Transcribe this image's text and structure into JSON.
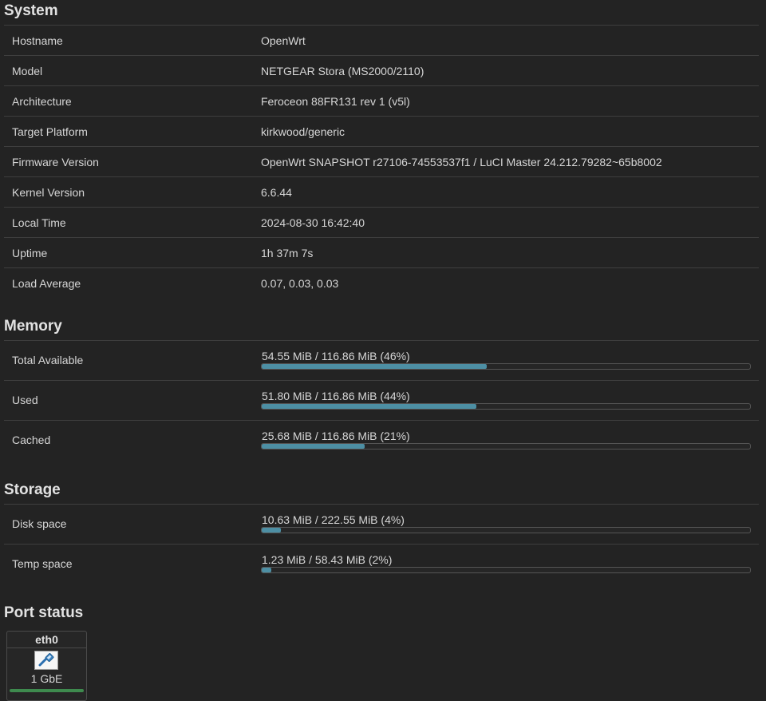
{
  "system": {
    "title": "System",
    "rows": [
      {
        "label": "Hostname",
        "value": "OpenWrt"
      },
      {
        "label": "Model",
        "value": "NETGEAR Stora (MS2000/2110)"
      },
      {
        "label": "Architecture",
        "value": "Feroceon 88FR131 rev 1 (v5l)"
      },
      {
        "label": "Target Platform",
        "value": "kirkwood/generic"
      },
      {
        "label": "Firmware Version",
        "value": "OpenWrt SNAPSHOT r27106-74553537f1 / LuCI Master 24.212.79282~65b8002"
      },
      {
        "label": "Kernel Version",
        "value": "6.6.44"
      },
      {
        "label": "Local Time",
        "value": "2024-08-30 16:42:40"
      },
      {
        "label": "Uptime",
        "value": "1h 37m 7s"
      },
      {
        "label": "Load Average",
        "value": "0.07, 0.03, 0.03"
      }
    ]
  },
  "memory": {
    "title": "Memory",
    "rows": [
      {
        "label": "Total Available",
        "text": "54.55 MiB / 116.86 MiB (46%)",
        "percent": 46
      },
      {
        "label": "Used",
        "text": "51.80 MiB / 116.86 MiB (44%)",
        "percent": 44
      },
      {
        "label": "Cached",
        "text": "25.68 MiB / 116.86 MiB (21%)",
        "percent": 21
      }
    ]
  },
  "storage": {
    "title": "Storage",
    "rows": [
      {
        "label": "Disk space",
        "text": "10.63 MiB / 222.55 MiB (4%)",
        "percent": 4
      },
      {
        "label": "Temp space",
        "text": "1.23 MiB / 58.43 MiB (2%)",
        "percent": 2
      }
    ]
  },
  "port_status": {
    "title": "Port status",
    "ports": [
      {
        "name": "eth0",
        "speed": "1 GbE",
        "icon": "ethernet-port-icon",
        "link_color": "#3e8a4e"
      }
    ]
  },
  "colors": {
    "background": "#232323",
    "bar_fill": "#4d8fa4",
    "link_up": "#3e8a4e"
  }
}
